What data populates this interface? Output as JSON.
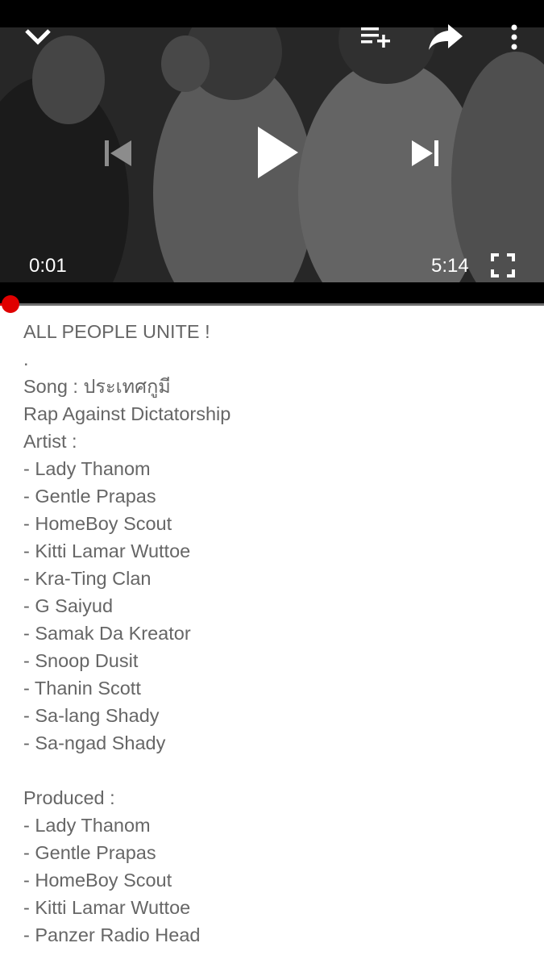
{
  "player": {
    "current_time": "0:01",
    "duration": "5:14",
    "progress_fraction": 0.003,
    "accent_color": "#e00000",
    "icons": {
      "collapse": "chevron-down-icon",
      "add_to_playlist": "playlist-add-icon",
      "share": "share-icon",
      "more": "more-vert-icon",
      "previous": "skip-previous-icon",
      "play": "play-icon",
      "next": "skip-next-icon",
      "fullscreen": "fullscreen-icon"
    }
  },
  "description": {
    "lines": [
      "ALL PEOPLE UNITE !",
      ".",
      "Song : ประเทศกูมี",
      "Rap Against Dictatorship",
      "Artist :",
      "- Lady Thanom",
      "- Gentle Prapas",
      "- HomeBoy Scout",
      "- Kitti Lamar Wuttoe",
      "- Kra-Ting Clan",
      "- G Saiyud",
      "- Samak Da Kreator",
      "- Snoop Dusit",
      "- Thanin Scott",
      "- Sa-lang Shady",
      "- Sa-ngad Shady",
      "",
      "Produced :",
      "- Lady Thanom",
      "- Gentle Prapas",
      "- HomeBoy Scout",
      "- Kitti Lamar Wuttoe",
      "- Panzer Radio Head"
    ]
  }
}
